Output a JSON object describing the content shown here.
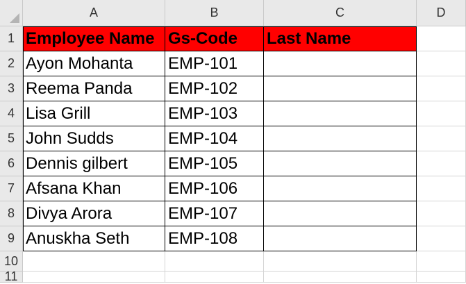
{
  "columns": [
    "A",
    "B",
    "C",
    "D"
  ],
  "rows": [
    "1",
    "2",
    "3",
    "4",
    "5",
    "6",
    "7",
    "8",
    "9",
    "10",
    "11"
  ],
  "table": {
    "headers": [
      "Employee Name",
      "Gs-Code",
      "Last Name"
    ],
    "data": [
      [
        "Ayon Mohanta",
        "EMP-101",
        ""
      ],
      [
        "Reema Panda",
        "EMP-102",
        ""
      ],
      [
        "Lisa Grill",
        "EMP-103",
        ""
      ],
      [
        "John Sudds",
        "EMP-104",
        ""
      ],
      [
        "Dennis gilbert",
        "EMP-105",
        ""
      ],
      [
        "Afsana Khan",
        "EMP-106",
        ""
      ],
      [
        "Divya Arora",
        "EMP-107",
        ""
      ],
      [
        "Anuskha Seth",
        "EMP-108",
        ""
      ]
    ]
  },
  "colors": {
    "header_fill": "#ff0000",
    "grid": "#d4d4d4",
    "heading_bg": "#e9e9e9"
  }
}
